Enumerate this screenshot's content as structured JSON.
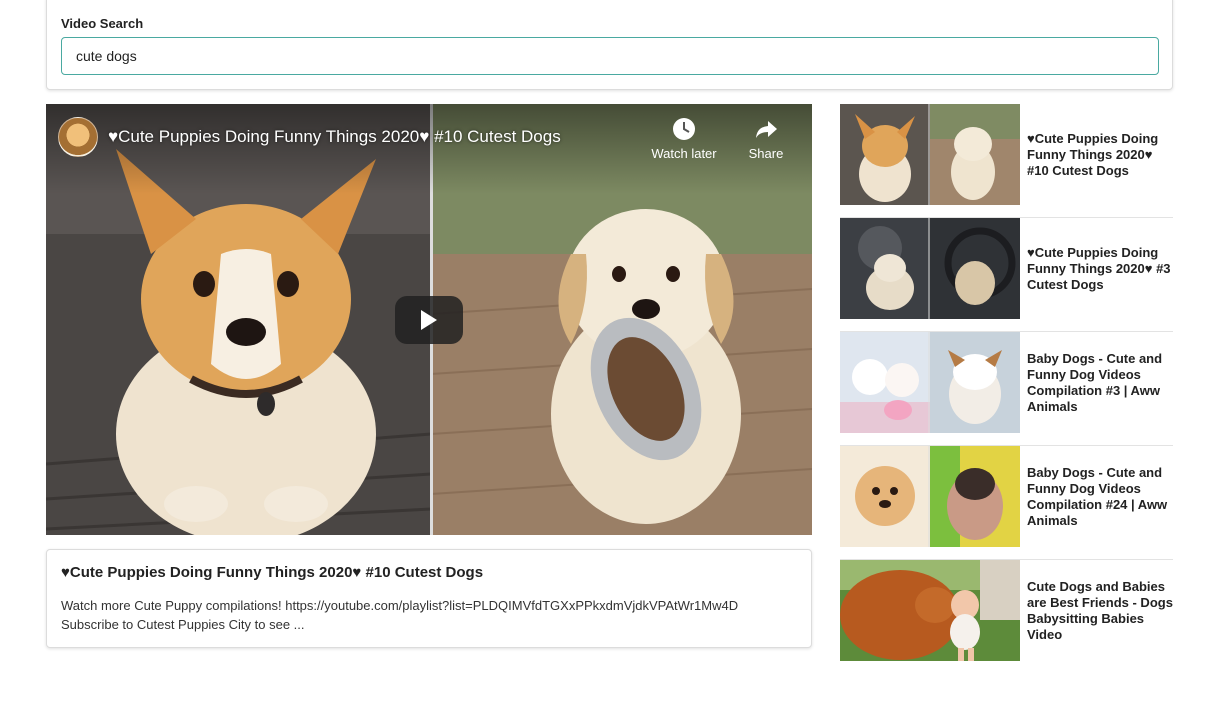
{
  "search": {
    "label": "Video Search",
    "value": "cute dogs"
  },
  "player": {
    "title": "♥Cute Puppies Doing Funny Things 2020♥ #10 Cutest Dogs",
    "watch_later_label": "Watch later",
    "share_label": "Share"
  },
  "details": {
    "title": "♥Cute Puppies Doing Funny Things 2020♥ #10 Cutest Dogs",
    "description_line1": "Watch more Cute Puppy compilations! https://youtube.com/playlist?list=PLDQIMVfdTGXxPPkxdmVjdkVPAtWr1Mw4D",
    "description_line2": "Subscribe to Cutest Puppies City to see ..."
  },
  "video_list": [
    {
      "title": "♥Cute Puppies Doing Funny Things 2020♥ #10 Cutest Dogs"
    },
    {
      "title": "♥Cute Puppies Doing Funny Things 2020♥ #3 Cutest Dogs"
    },
    {
      "title": "Baby Dogs - Cute and Funny Dog Videos Compilation #3 | Aww Animals"
    },
    {
      "title": "Baby Dogs - Cute and Funny Dog Videos Compilation #24 | Aww Animals"
    },
    {
      "title": "Cute Dogs and Babies are Best Friends - Dogs Babysitting Babies Video"
    }
  ],
  "colors": {
    "accent_border": "#4aa9a1",
    "card_border": "#dcdcdc"
  },
  "icons": {
    "watch_later": "clock-icon",
    "share": "share-arrow-icon",
    "play": "play-icon"
  }
}
